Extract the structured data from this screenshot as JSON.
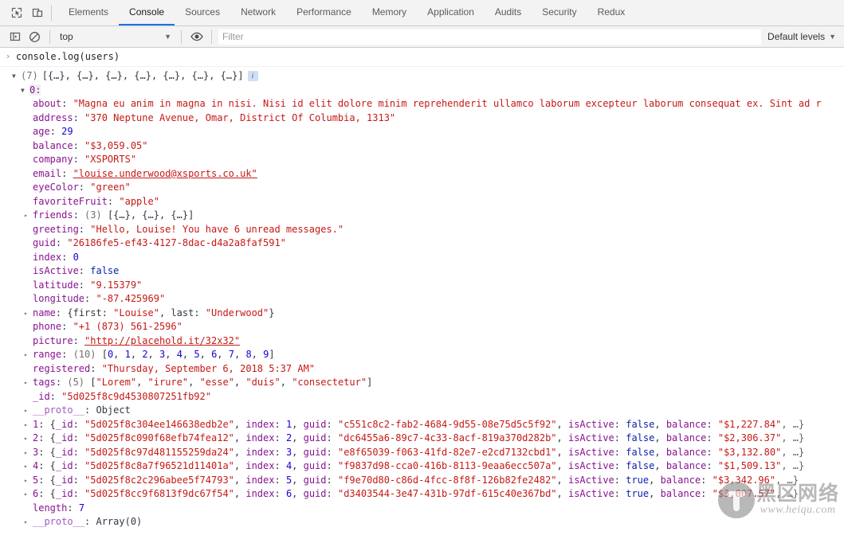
{
  "toolbar": {
    "icons": [
      {
        "name": "inspect-element-icon",
        "title": "Inspect element"
      },
      {
        "name": "device-toolbar-icon",
        "title": "Toggle device toolbar"
      }
    ],
    "tabs": [
      {
        "label": "Elements",
        "active": false
      },
      {
        "label": "Console",
        "active": true
      },
      {
        "label": "Sources",
        "active": false
      },
      {
        "label": "Network",
        "active": false
      },
      {
        "label": "Performance",
        "active": false
      },
      {
        "label": "Memory",
        "active": false
      },
      {
        "label": "Application",
        "active": false
      },
      {
        "label": "Audits",
        "active": false
      },
      {
        "label": "Security",
        "active": false
      },
      {
        "label": "Redux",
        "active": false
      }
    ]
  },
  "filterbar": {
    "sidebar_toggle_icon": "show-console-sidebar-icon",
    "clear_icon": "clear-console-icon",
    "context": "top",
    "context_caret": "▼",
    "eye_icon": "live-expression-eye-icon",
    "filter_value": "",
    "filter_placeholder": "Filter",
    "levels_label": "Default levels",
    "levels_caret": "▼"
  },
  "console": {
    "prompt_arrow": "›",
    "command": "console.log(users)",
    "array_header": {
      "triangle": "▼",
      "count": "(7)",
      "preview": "[{…}, {…}, {…}, {…}, {…}, {…}, {…}]",
      "info_badge": "i"
    },
    "index_row": {
      "triangle": "▼",
      "label": "0:"
    },
    "properties": [
      {
        "key": "about",
        "sep": ": ",
        "value": "\"Magna eu anim in magna in nisi. Nisi id elit dolore minim reprehenderit ullamco laborum excepteur laborum consequat ex. Sint ad r",
        "type": "string",
        "expandable": false
      },
      {
        "key": "address",
        "sep": ": ",
        "value": "\"370 Neptune Avenue, Omar, District Of Columbia, 1313\"",
        "type": "string",
        "expandable": false
      },
      {
        "key": "age",
        "sep": ": ",
        "value": "29",
        "type": "number",
        "expandable": false
      },
      {
        "key": "balance",
        "sep": ": ",
        "value": "\"$3,059.05\"",
        "type": "string",
        "expandable": false
      },
      {
        "key": "company",
        "sep": ": ",
        "value": "\"XSPORTS\"",
        "type": "string",
        "expandable": false
      },
      {
        "key": "email",
        "sep": ": ",
        "value": "\"louise.underwood@xsports.co.uk\"",
        "type": "link",
        "expandable": false
      },
      {
        "key": "eyeColor",
        "sep": ": ",
        "value": "\"green\"",
        "type": "string",
        "expandable": false
      },
      {
        "key": "favoriteFruit",
        "sep": ": ",
        "value": "\"apple\"",
        "type": "string",
        "expandable": false
      },
      {
        "key": "friends",
        "sep": ": ",
        "value": "(3) [{…}, {…}, {…}]",
        "type": "array-preview",
        "expandable": true
      },
      {
        "key": "greeting",
        "sep": ": ",
        "value": "\"Hello, Louise! You have 6 unread messages.\"",
        "type": "string",
        "expandable": false
      },
      {
        "key": "guid",
        "sep": ": ",
        "value": "\"26186fe5-ef43-4127-8dac-d4a2a8faf591\"",
        "type": "string",
        "expandable": false
      },
      {
        "key": "index",
        "sep": ": ",
        "value": "0",
        "type": "number",
        "expandable": false
      },
      {
        "key": "isActive",
        "sep": ": ",
        "value": "false",
        "type": "boolean",
        "expandable": false
      },
      {
        "key": "latitude",
        "sep": ": ",
        "value": "\"9.15379\"",
        "type": "string",
        "expandable": false
      },
      {
        "key": "longitude",
        "sep": ": ",
        "value": "\"-87.425969\"",
        "type": "string",
        "expandable": false
      },
      {
        "key": "name",
        "sep": ": ",
        "value": "{first: \"Louise\", last: \"Underwood\"}",
        "type": "object-preview",
        "expandable": true,
        "parts": [
          {
            "t": "plain",
            "s": "{"
          },
          {
            "t": "plain",
            "s": "first: "
          },
          {
            "t": "string",
            "s": "\"Louise\""
          },
          {
            "t": "plain",
            "s": ", last: "
          },
          {
            "t": "string",
            "s": "\"Underwood\""
          },
          {
            "t": "plain",
            "s": "}"
          }
        ]
      },
      {
        "key": "phone",
        "sep": ": ",
        "value": "\"+1 (873) 561-2596\"",
        "type": "string",
        "expandable": false
      },
      {
        "key": "picture",
        "sep": ": ",
        "value": "\"http://placehold.it/32x32\"",
        "type": "link",
        "expandable": false
      },
      {
        "key": "range",
        "sep": ": ",
        "value": "(10) [0, 1, 2, 3, 4, 5, 6, 7, 8, 9]",
        "type": "number-array",
        "expandable": true,
        "count": "(10)",
        "numbers": [
          "0",
          "1",
          "2",
          "3",
          "4",
          "5",
          "6",
          "7",
          "8",
          "9"
        ]
      },
      {
        "key": "registered",
        "sep": ": ",
        "value": "\"Thursday, September 6, 2018 5:37 AM\"",
        "type": "string",
        "expandable": false
      },
      {
        "key": "tags",
        "sep": ": ",
        "value": "(5) [\"Lorem\", \"irure\", \"esse\", \"duis\", \"consectetur\"]",
        "type": "string-array",
        "expandable": true,
        "count": "(5)",
        "strings": [
          "\"Lorem\"",
          "\"irure\"",
          "\"esse\"",
          "\"duis\"",
          "\"consectetur\""
        ]
      },
      {
        "key": "_id",
        "sep": ": ",
        "value": "\"5d025f8c9d4530807251fb92\"",
        "type": "string",
        "expandable": false
      },
      {
        "key": "__proto__",
        "sep": ": ",
        "value": "Object",
        "type": "proto",
        "expandable": true
      }
    ],
    "collapsed_rows": [
      {
        "index": "1",
        "id": "\"5d025f8c304ee146638edb2e\"",
        "idx_value": "1",
        "guid": "\"c551c8c2-fab2-4684-9d55-08e75d5c5f92\"",
        "is_active": "false",
        "balance": "\"$1,227.84\""
      },
      {
        "index": "2",
        "id": "\"5d025f8c090f68efb74fea12\"",
        "idx_value": "2",
        "guid": "\"dc6455a6-89c7-4c33-8acf-819a370d282b\"",
        "is_active": "false",
        "balance": "\"$2,306.37\""
      },
      {
        "index": "3",
        "id": "\"5d025f8c97d481155259da24\"",
        "idx_value": "3",
        "guid": "\"e8f65039-f063-41fd-82e7-e2cd7132cbd1\"",
        "is_active": "false",
        "balance": "\"$3,132.80\""
      },
      {
        "index": "4",
        "id": "\"5d025f8c8a7f96521d11401a\"",
        "idx_value": "4",
        "guid": "\"f9837d98-cca0-416b-8113-9eaa6ecc507a\"",
        "is_active": "false",
        "balance": "\"$1,509.13\""
      },
      {
        "index": "5",
        "id": "\"5d025f8c2c296abee5f74793\"",
        "idx_value": "5",
        "guid": "\"f9e70d80-c86d-4fcc-8f8f-126b82fe2482\"",
        "is_active": "true",
        "balance": "\"$3,342.96\""
      },
      {
        "index": "6",
        "id": "\"5d025f8cc9f6813f9dc67f54\"",
        "idx_value": "6",
        "guid": "\"d3403544-3e47-431b-97df-615c40e367bd\"",
        "is_active": "true",
        "balance": "\"$3,007.57\""
      }
    ],
    "row_labels": {
      "id_key": "_id",
      "index_key": "index",
      "guid_key": "guid",
      "is_active_key": "isActive",
      "balance_key": "balance",
      "open_brace": "{",
      "ellipsis_close": ", …}",
      "comma": ", "
    },
    "length_row": {
      "key": "length",
      "value": "7"
    },
    "proto_row": {
      "key": "__proto__",
      "value": "Array(0)",
      "triangle": "▸"
    }
  },
  "watermark": {
    "cn_text": "黑区网络",
    "url_text": "www.heiqu.com"
  },
  "colors": {
    "accent": "#1a73e8",
    "property": "#881391",
    "string": "#c41a16",
    "number": "#1c00cf",
    "boolean": "#0d22aa",
    "toolbar_bg": "#f3f3f3"
  }
}
